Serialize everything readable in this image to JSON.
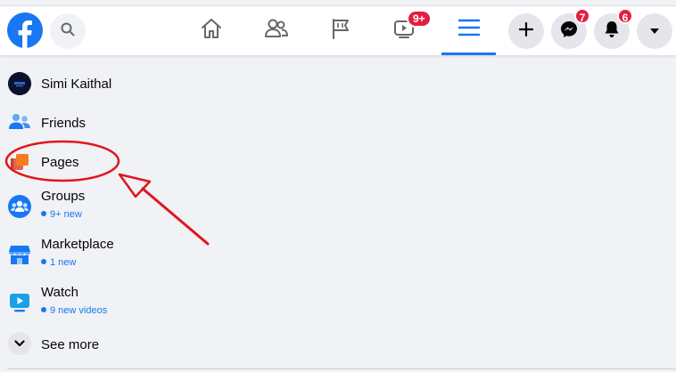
{
  "topbar": {
    "logo_icon": "facebook-logo",
    "search_icon": "search-icon",
    "tabs": [
      {
        "name": "home",
        "icon": "home-icon",
        "active": false
      },
      {
        "name": "friends",
        "icon": "friends-icon",
        "active": false
      },
      {
        "name": "pages",
        "icon": "flag-icon",
        "active": false
      },
      {
        "name": "watch",
        "icon": "video-icon",
        "active": false,
        "badge": "9+"
      },
      {
        "name": "menu",
        "icon": "menu-icon",
        "active": true
      }
    ],
    "actions": [
      {
        "name": "create",
        "icon": "plus-icon"
      },
      {
        "name": "messenger",
        "icon": "messenger-icon",
        "badge": "7"
      },
      {
        "name": "notifications",
        "icon": "bell-icon",
        "badge": "6"
      },
      {
        "name": "account",
        "icon": "caret-down-icon"
      }
    ]
  },
  "menu": {
    "profile_name": "Simi Kaithal",
    "items": [
      {
        "label": "Friends",
        "icon": "friends-icon"
      },
      {
        "label": "Pages",
        "icon": "pages-icon"
      },
      {
        "label": "Groups",
        "icon": "groups-icon",
        "sub": "9+ new"
      },
      {
        "label": "Marketplace",
        "icon": "marketplace-icon",
        "sub": "1 new"
      },
      {
        "label": "Watch",
        "icon": "watch-icon",
        "sub": "9 new videos"
      }
    ],
    "see_more": "See more"
  },
  "colors": {
    "brand": "#1877f2",
    "badge": "#e41e3f",
    "annotation": "#e0161d",
    "background": "#f0f2f5"
  }
}
